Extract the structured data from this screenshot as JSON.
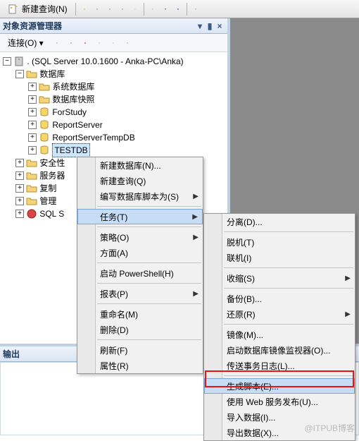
{
  "toolbar": {
    "new_query": "新建查询(N)"
  },
  "explorer": {
    "title": "对象资源管理器",
    "connect_label": "连接(O) ▾",
    "server": ". (SQL Server 10.0.1600 - Anka-PC\\Anka)",
    "nodes": {
      "databases": "数据库",
      "sys_db": "系统数据库",
      "snapshots": "数据库快照",
      "forstudy": "ForStudy",
      "reportserver": "ReportServer",
      "reportservertemp": "ReportServerTempDB",
      "testdb": "TESTDB",
      "security": "安全性",
      "server_objects": "服务器",
      "replication": "复制",
      "management": "管理",
      "sql_s": "SQL S"
    }
  },
  "output": {
    "title": "输出"
  },
  "menu1": {
    "new_db": "新建数据库(N)...",
    "new_query": "新建查询(Q)",
    "script_db_as": "编写数据库脚本为(S)",
    "tasks": "任务(T)",
    "policies": "策略(O)",
    "facets": "方面(A)",
    "powershell": "启动 PowerShell(H)",
    "reports": "报表(P)",
    "rename": "重命名(M)",
    "delete": "删除(D)",
    "refresh": "刷新(F)",
    "properties": "属性(R)"
  },
  "menu2": {
    "detach": "分离(D)...",
    "offline": "脱机(T)",
    "online": "联机(I)",
    "shrink": "收缩(S)",
    "backup": "备份(B)...",
    "restore": "还原(R)",
    "mirror": "镜像(M)...",
    "launch_monitor": "启动数据库镜像监视器(O)...",
    "ship_logs": "传送事务日志(L)...",
    "gen_scripts": "生成脚本(E)...",
    "publish_web": "使用 Web 服务发布(U)...",
    "import": "导入数据(I)...",
    "export": "导出数据(X)..."
  },
  "watermark": "@ITPUB博客"
}
